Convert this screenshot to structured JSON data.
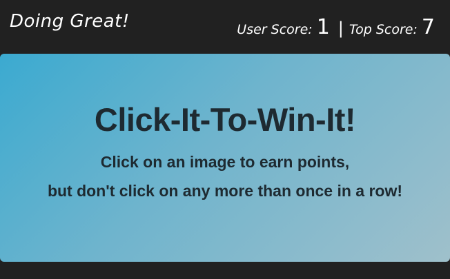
{
  "navbar": {
    "status_text": "Doing Great!",
    "user_score_label": "User Score:",
    "user_score_value": "1",
    "separator": "|",
    "top_score_label": "Top Score:",
    "top_score_value": "7"
  },
  "jumbotron": {
    "title": "Click-It-To-Win-It!",
    "line1": "Click on an image to earn points,",
    "line2": "but don't click on any more than once in a row!"
  },
  "colors": {
    "navbar_bg": "#212121",
    "gradient_start": "#3baad0",
    "gradient_end": "#9fc0cb",
    "heading_text": "#1e2a31"
  }
}
